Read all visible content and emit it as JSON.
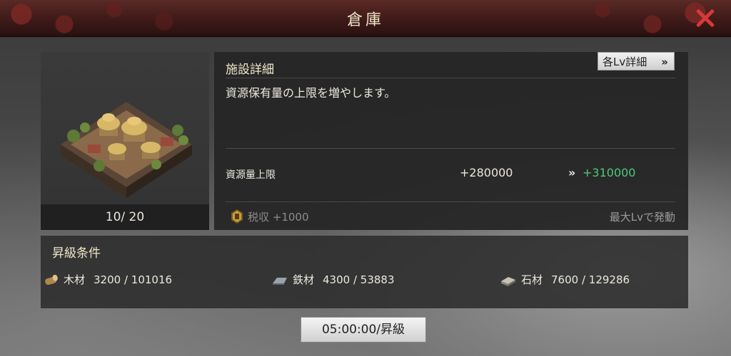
{
  "header": {
    "title": "倉庫"
  },
  "building": {
    "level_text": "10/ 20"
  },
  "detail": {
    "heading": "施設詳細",
    "lv_button_label": "各Lv詳細",
    "lv_button_chevron": "»",
    "description": "資源保有量の上限を増やします。",
    "stat": {
      "label": "資源量上限",
      "current": "+280000",
      "arrow": "»",
      "next": "+310000"
    },
    "tax": "税収 +1000",
    "max_note": "最大Lvで発動"
  },
  "conditions": {
    "heading": "昇級条件",
    "resources": [
      {
        "name": "木材",
        "amount": "3200 / 101016",
        "icon": "wood-log-icon"
      },
      {
        "name": "鉄材",
        "amount": "4300 / 53883",
        "icon": "iron-ingot-icon"
      },
      {
        "name": "石材",
        "amount": "7600 / 129286",
        "icon": "stone-block-icon"
      }
    ]
  },
  "upgrade_button": {
    "label": "05:00:00/昇級"
  },
  "colors": {
    "accent_green": "#4cc97a",
    "close_red": "#d9383a",
    "header_bg": "#4a2220"
  }
}
